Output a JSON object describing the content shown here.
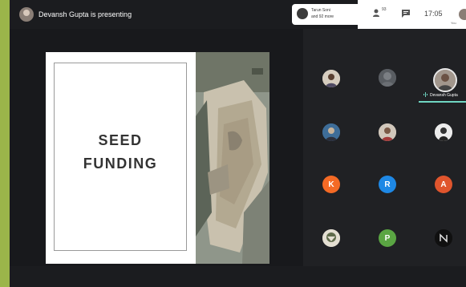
{
  "header": {
    "presenting_text": "Devansh Gupta is presenting",
    "participants_chip": {
      "line1": "Tarun Soni",
      "line2": "and 92 more"
    },
    "people_count": "93",
    "time": "17:05",
    "self_label": "You"
  },
  "slide": {
    "title_line1": "SEED",
    "title_line2": "FUNDING"
  },
  "participants": {
    "active_speaker_name": "Devansh Gupta",
    "tiles": [
      {
        "kind": "photo",
        "icon": "person-avatar"
      },
      {
        "kind": "photo",
        "icon": "person-avatar"
      },
      {
        "kind": "photo",
        "icon": "person-avatar"
      },
      {
        "kind": "photo",
        "icon": "person-avatar"
      },
      {
        "kind": "photo",
        "icon": "person-avatar"
      },
      {
        "kind": "photo",
        "icon": "person-avatar"
      },
      {
        "kind": "initial",
        "letter": "K",
        "color": "#f46a25"
      },
      {
        "kind": "initial",
        "letter": "R",
        "color": "#1e88e5"
      },
      {
        "kind": "initial",
        "letter": "A",
        "color": "#e0552d"
      },
      {
        "kind": "photo",
        "icon": "person-avatar"
      },
      {
        "kind": "initial",
        "letter": "P",
        "color": "#5aa543"
      },
      {
        "kind": "photo",
        "icon": "n-logo"
      }
    ]
  },
  "colors": {
    "frame": "#9bb54a",
    "background": "#202124",
    "speaking_accent": "#6fd6c2"
  }
}
